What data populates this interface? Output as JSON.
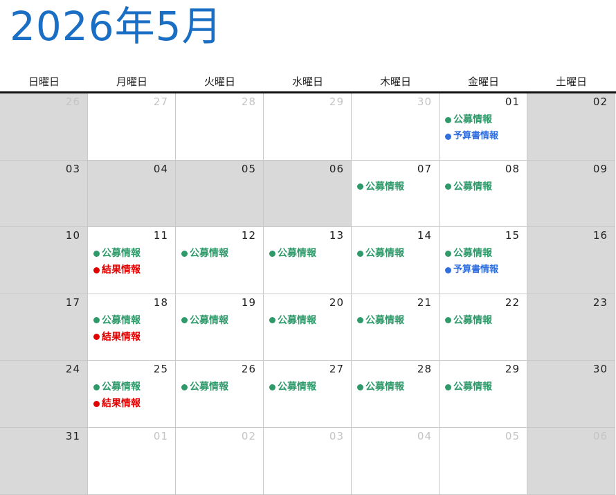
{
  "title": "2026年5月",
  "weekdays": [
    "日曜日",
    "月曜日",
    "火曜日",
    "水曜日",
    "木曜日",
    "金曜日",
    "土曜日"
  ],
  "colors": {
    "title": "#1a6fc4",
    "koubo": "#2e9a6a",
    "kekka": "#e10000",
    "yosan": "#2f6fe0",
    "shaded_cell": "#d9d9d9",
    "other_month_date": "#c4c4c4"
  },
  "event_types": {
    "koubo": "公募情報",
    "kekka": "結果情報",
    "yosan": "予算書情報"
  },
  "weeks": [
    [
      {
        "date": "26",
        "other": true,
        "shaded": true,
        "events": []
      },
      {
        "date": "27",
        "other": true,
        "shaded": false,
        "events": []
      },
      {
        "date": "28",
        "other": true,
        "shaded": false,
        "events": []
      },
      {
        "date": "29",
        "other": true,
        "shaded": false,
        "events": []
      },
      {
        "date": "30",
        "other": true,
        "shaded": false,
        "events": []
      },
      {
        "date": "01",
        "other": false,
        "shaded": false,
        "events": [
          "koubo",
          "yosan"
        ]
      },
      {
        "date": "02",
        "other": false,
        "shaded": true,
        "events": []
      }
    ],
    [
      {
        "date": "03",
        "other": false,
        "shaded": true,
        "events": []
      },
      {
        "date": "04",
        "other": false,
        "shaded": true,
        "events": []
      },
      {
        "date": "05",
        "other": false,
        "shaded": true,
        "events": []
      },
      {
        "date": "06",
        "other": false,
        "shaded": true,
        "events": []
      },
      {
        "date": "07",
        "other": false,
        "shaded": false,
        "events": [
          "koubo"
        ]
      },
      {
        "date": "08",
        "other": false,
        "shaded": false,
        "events": [
          "koubo"
        ]
      },
      {
        "date": "09",
        "other": false,
        "shaded": true,
        "events": []
      }
    ],
    [
      {
        "date": "10",
        "other": false,
        "shaded": true,
        "events": []
      },
      {
        "date": "11",
        "other": false,
        "shaded": false,
        "events": [
          "koubo",
          "kekka"
        ]
      },
      {
        "date": "12",
        "other": false,
        "shaded": false,
        "events": [
          "koubo"
        ]
      },
      {
        "date": "13",
        "other": false,
        "shaded": false,
        "events": [
          "koubo"
        ]
      },
      {
        "date": "14",
        "other": false,
        "shaded": false,
        "events": [
          "koubo"
        ]
      },
      {
        "date": "15",
        "other": false,
        "shaded": false,
        "events": [
          "koubo",
          "yosan"
        ]
      },
      {
        "date": "16",
        "other": false,
        "shaded": true,
        "events": []
      }
    ],
    [
      {
        "date": "17",
        "other": false,
        "shaded": true,
        "events": []
      },
      {
        "date": "18",
        "other": false,
        "shaded": false,
        "events": [
          "koubo",
          "kekka"
        ]
      },
      {
        "date": "19",
        "other": false,
        "shaded": false,
        "events": [
          "koubo"
        ]
      },
      {
        "date": "20",
        "other": false,
        "shaded": false,
        "events": [
          "koubo"
        ]
      },
      {
        "date": "21",
        "other": false,
        "shaded": false,
        "events": [
          "koubo"
        ]
      },
      {
        "date": "22",
        "other": false,
        "shaded": false,
        "events": [
          "koubo"
        ]
      },
      {
        "date": "23",
        "other": false,
        "shaded": true,
        "events": []
      }
    ],
    [
      {
        "date": "24",
        "other": false,
        "shaded": true,
        "events": []
      },
      {
        "date": "25",
        "other": false,
        "shaded": false,
        "events": [
          "koubo",
          "kekka"
        ]
      },
      {
        "date": "26",
        "other": false,
        "shaded": false,
        "events": [
          "koubo"
        ]
      },
      {
        "date": "27",
        "other": false,
        "shaded": false,
        "events": [
          "koubo"
        ]
      },
      {
        "date": "28",
        "other": false,
        "shaded": false,
        "events": [
          "koubo"
        ]
      },
      {
        "date": "29",
        "other": false,
        "shaded": false,
        "events": [
          "koubo"
        ]
      },
      {
        "date": "30",
        "other": false,
        "shaded": true,
        "events": []
      }
    ],
    [
      {
        "date": "31",
        "other": false,
        "shaded": true,
        "events": []
      },
      {
        "date": "01",
        "other": true,
        "shaded": false,
        "events": []
      },
      {
        "date": "02",
        "other": true,
        "shaded": false,
        "events": []
      },
      {
        "date": "03",
        "other": true,
        "shaded": false,
        "events": []
      },
      {
        "date": "04",
        "other": true,
        "shaded": false,
        "events": []
      },
      {
        "date": "05",
        "other": true,
        "shaded": false,
        "events": []
      },
      {
        "date": "06",
        "other": true,
        "shaded": true,
        "events": []
      }
    ]
  ]
}
